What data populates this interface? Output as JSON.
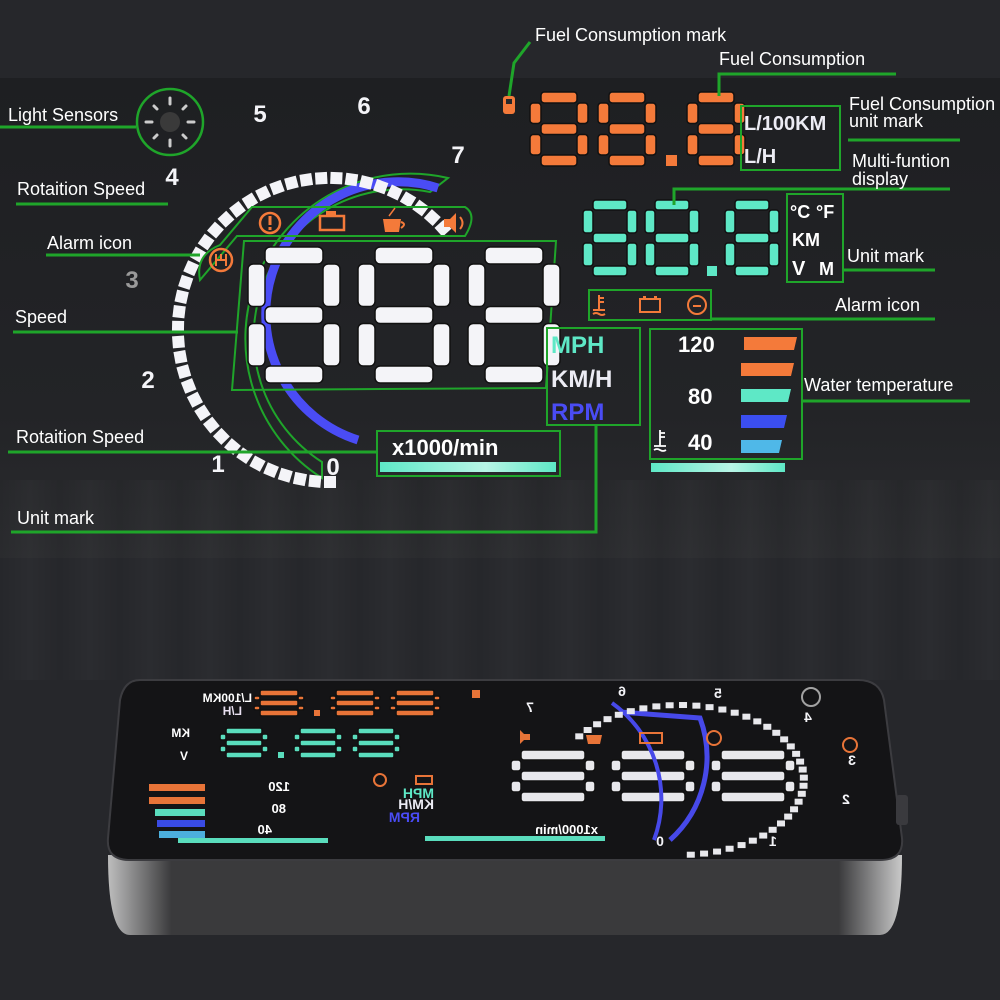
{
  "annotations": {
    "light_sensors": "Light Sensors",
    "rotation_speed_top": "Rotaition Speed",
    "alarm_icon_left": "Alarm icon",
    "speed": "Speed",
    "rotation_speed_bottom": "Rotaition Speed",
    "unit_mark_bottom": "Unit mark",
    "fuel_consumption_mark": "Fuel Consumption  mark",
    "fuel_consumption": "Fuel Consumption",
    "fuel_unit_mark_line1": "Fuel Consumption",
    "fuel_unit_mark_line2": "unit mark",
    "multi_function_line1": "Multi-funtion",
    "multi_function_line2": "display",
    "unit_mark_right": "Unit mark",
    "alarm_icon_right": "Alarm icon",
    "water_temperature": "Water temperature"
  },
  "hud": {
    "tach_numbers": [
      "0",
      "1",
      "2",
      "3",
      "4",
      "5",
      "6",
      "7"
    ],
    "speed_digits": "888",
    "fuel_digits": "88.8",
    "fuel_units": [
      "L/100KM",
      "L/H"
    ],
    "multi_digits": "88.8",
    "multi_units": [
      "°C",
      "°F",
      "KM",
      "V",
      "M"
    ],
    "speed_units": [
      "MPH",
      "KM/H",
      "RPM"
    ],
    "rpm_unit": "x1000/min",
    "water_temp_labels": [
      "120",
      "80",
      "40"
    ],
    "top_alarm_icons": [
      "brake-warning-icon",
      "engine-check-icon",
      "coffee-fatigue-icon",
      "speaker-icon"
    ],
    "side_alarm_icon": "gear-shift-icon",
    "right_alarm_icons": [
      "water-temp-icon",
      "battery-icon",
      "speed-limit-icon"
    ],
    "fuel_icon": "fuel-pump-icon",
    "light_sensor_icon": "light-sensor-icon"
  },
  "colors": {
    "annotation_green": "#1fa52a",
    "orange": "#f47a3a",
    "teal": "#5ee8c6",
    "blue": "#4a4cf5",
    "light_blue": "#4fb8e8",
    "white": "#f2f2f6"
  }
}
